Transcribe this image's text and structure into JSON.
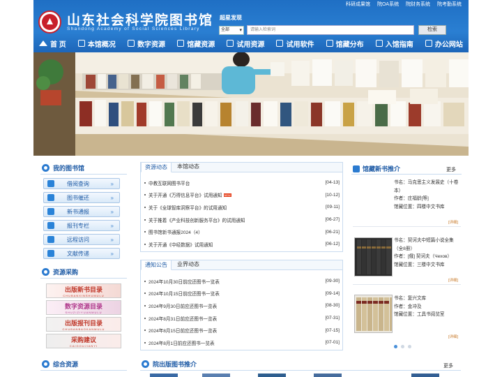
{
  "header": {
    "logo_cn": "山东社会科学院图书馆",
    "logo_en": "Shandong Academy of Social Sciences Library",
    "logo_seal_text": "SASS",
    "top_links": [
      "科研成果馆",
      "院OA系统",
      "院财务系统",
      "院考勤系统"
    ],
    "search": {
      "title": "超星发现",
      "scope": "全部",
      "placeholder": "请输入检索词",
      "button": "检索"
    },
    "nav": [
      "首 页",
      "本馆概况",
      "数字资源",
      "馆藏资源",
      "试用资源",
      "试用软件",
      "馆藏分布",
      "入馆指南",
      "办公网站"
    ]
  },
  "left": {
    "my_library_title": "我的图书馆",
    "my_library_items": [
      "借阅查询",
      "图书催还",
      "新书通报",
      "报刊专栏",
      "远程访问",
      "文献传递"
    ],
    "resource_title": "资源采购",
    "resource_banners": [
      {
        "title": "出版新书目录",
        "sub": "CHUBANXINSHUMULU",
        "color": "#c0392b"
      },
      {
        "title": "数字资源目录",
        "sub": "SHUZIZIYUANMULU",
        "color": "#b03a8c"
      },
      {
        "title": "出版报刊目录",
        "sub": "CHUBANBAOKANMULU",
        "color": "#c0392b"
      },
      {
        "title": "采购建议",
        "sub": "CAIGOUJIANYI",
        "color": "#c0392b"
      }
    ],
    "general_title": "综合资源"
  },
  "middle": {
    "tabs1": [
      "资源动态",
      "本馆动态"
    ],
    "news1": [
      {
        "title": "中教互联网图书平台",
        "date": "[04-13]",
        "is_new": false
      },
      {
        "title": "关于开通《万得信息平台》试用通知",
        "date": "[10-12]",
        "is_new": true
      },
      {
        "title": "关于《全球智库洞察平台》的试用通知",
        "date": "[09-11]",
        "is_new": false
      },
      {
        "title": "关于推着《产业科技创新服务平台》的试用通知",
        "date": "[06-27]",
        "is_new": false
      },
      {
        "title": "图书馆新书通报2024（4）",
        "date": "[06-21]",
        "is_new": false
      },
      {
        "title": "关于开通《中经数据》试用通知",
        "date": "[06-12]",
        "is_new": false
      }
    ],
    "new_label": "NEW",
    "tabs2": [
      "通知公告",
      "业界动态"
    ],
    "news2": [
      {
        "title": "2024年10月30日前应还图书一览表",
        "date": "[09-30]"
      },
      {
        "title": "2024年10月15日前应还图书一览表",
        "date": "[09-14]"
      },
      {
        "title": "2024年9月30日前应还图书一览表",
        "date": "[08-30]"
      },
      {
        "title": "2024年8月31日前应还图书一览表",
        "date": "[07-31]"
      },
      {
        "title": "2024年8月15日前应还图书一览表",
        "date": "[07-15]"
      },
      {
        "title": "2024年8月1日前应还图书一览表",
        "date": "[07-01]"
      }
    ],
    "published_title": "院出版图书推介",
    "published_more": "更多"
  },
  "right": {
    "title": "馆藏新书推介",
    "more": "更多",
    "detail": "[详细]",
    "books": [
      {
        "name": "书名：马克思主义发展史（十卷本）",
        "author": "作者：庄福龄[等]",
        "location": "馆藏位置：四楼中文书库"
      },
      {
        "name": "书名：契诃夫中短篇小说全集（全8册）",
        "author": "作者：[俄] 契诃夫（Чехов）",
        "location": "馆藏位置：三楼中文书库"
      },
      {
        "name": "书名：复兴文库",
        "author": "作者：金冲及",
        "location": "馆藏位置：工具书阅览室"
      }
    ]
  }
}
